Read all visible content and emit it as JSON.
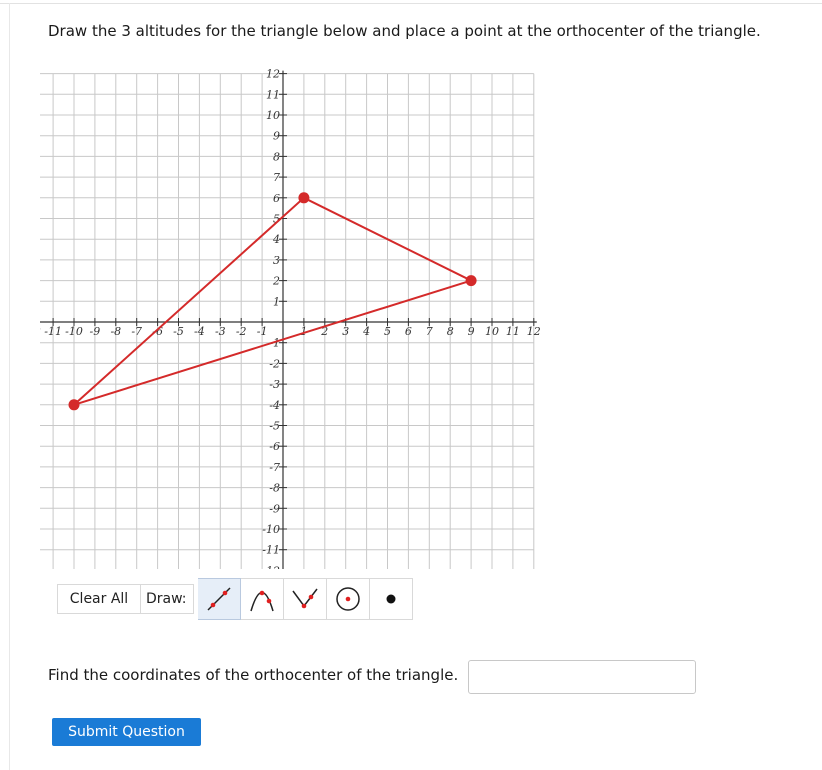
{
  "prompt": "Draw the 3 altitudes for the triangle below and place a point at the orthocenter of the triangle.",
  "graph": {
    "x_range": [
      -12,
      12
    ],
    "y_range": [
      -12,
      12
    ],
    "grid": true,
    "triangle_color": "#d42a2a",
    "triangle": [
      {
        "x": 1,
        "y": 6
      },
      {
        "x": 9,
        "y": 2
      },
      {
        "x": -10,
        "y": -4
      }
    ]
  },
  "toolbar": {
    "clear_label": "Clear All",
    "draw_label": "Draw:",
    "tools": [
      {
        "icon": "line-segment-icon",
        "active": true
      },
      {
        "icon": "parabola-icon",
        "active": false
      },
      {
        "icon": "absolute-value-icon",
        "active": false
      },
      {
        "icon": "circle-icon",
        "active": false
      },
      {
        "icon": "point-icon",
        "active": false
      }
    ]
  },
  "question": {
    "label": "Find the coordinates of the orthocenter of the triangle.",
    "value": ""
  },
  "submit_label": "Submit Question"
}
